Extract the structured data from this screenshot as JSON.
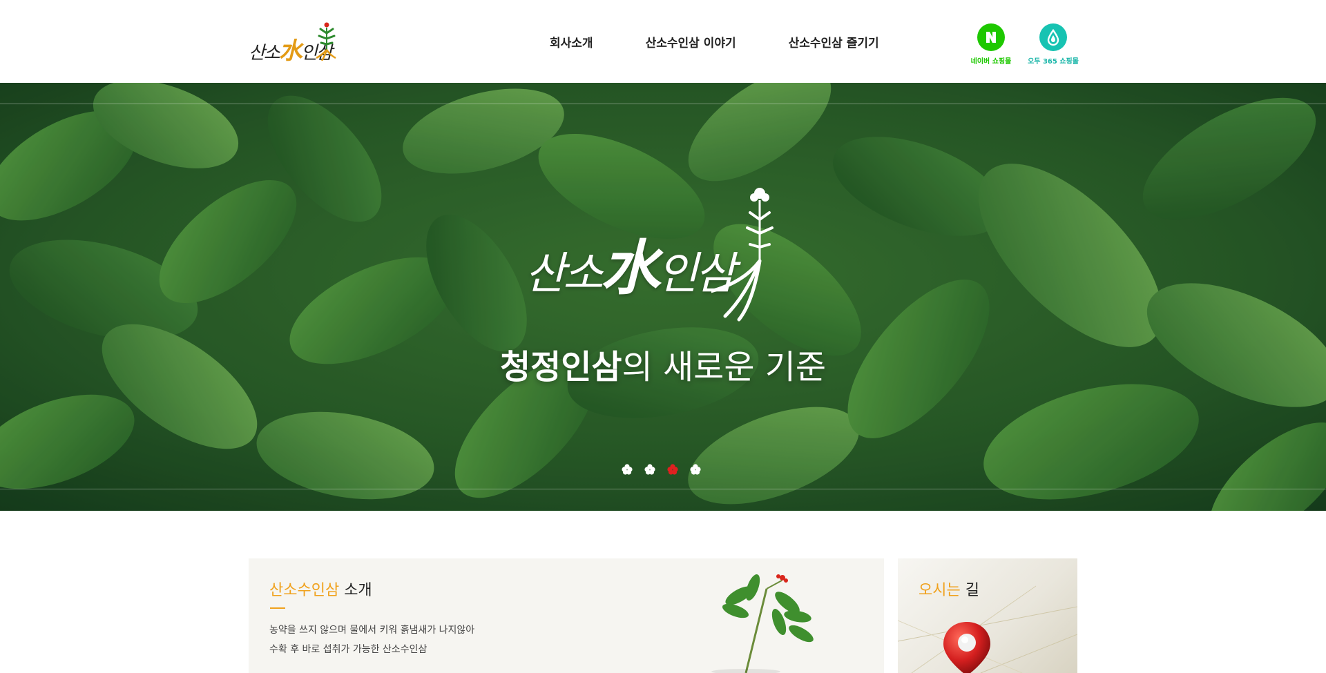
{
  "header": {
    "logo_text_1": "산소",
    "logo_text_water": "水",
    "logo_text_2": "인삼",
    "nav": [
      {
        "label": "회사소개"
      },
      {
        "label": "산소수인삼 이야기"
      },
      {
        "label": "산소수인삼 즐기기"
      }
    ],
    "shops": [
      {
        "icon": "naver-n-icon",
        "label": "네이버 쇼핑몰",
        "color": "#1ec800"
      },
      {
        "icon": "odu-drop-icon",
        "label": "오두 365 쇼핑몰",
        "color": "#17c3b2"
      }
    ]
  },
  "hero": {
    "logo_text_1": "산소",
    "logo_text_water": "水",
    "logo_text_2": "인삼",
    "tagline_bold": "청정인삼",
    "tagline_rest": "의 새로운 기준",
    "slides_total": 4,
    "active_slide": 3
  },
  "intro": {
    "title_accent": "산소수인삼",
    "title_rest": " 소개",
    "line1": "농약을 쓰지 않으며 물에서 키워 흙냄새가 나지않아",
    "line2": "수확 후 바로 섭취가 가능한 산소수인삼"
  },
  "map": {
    "title_accent": "오시는",
    "title_rest": " 길"
  },
  "colors": {
    "accent": "#f0a11c",
    "naver": "#1ec800",
    "odu": "#17c3b2",
    "active_dot": "#e02020"
  }
}
